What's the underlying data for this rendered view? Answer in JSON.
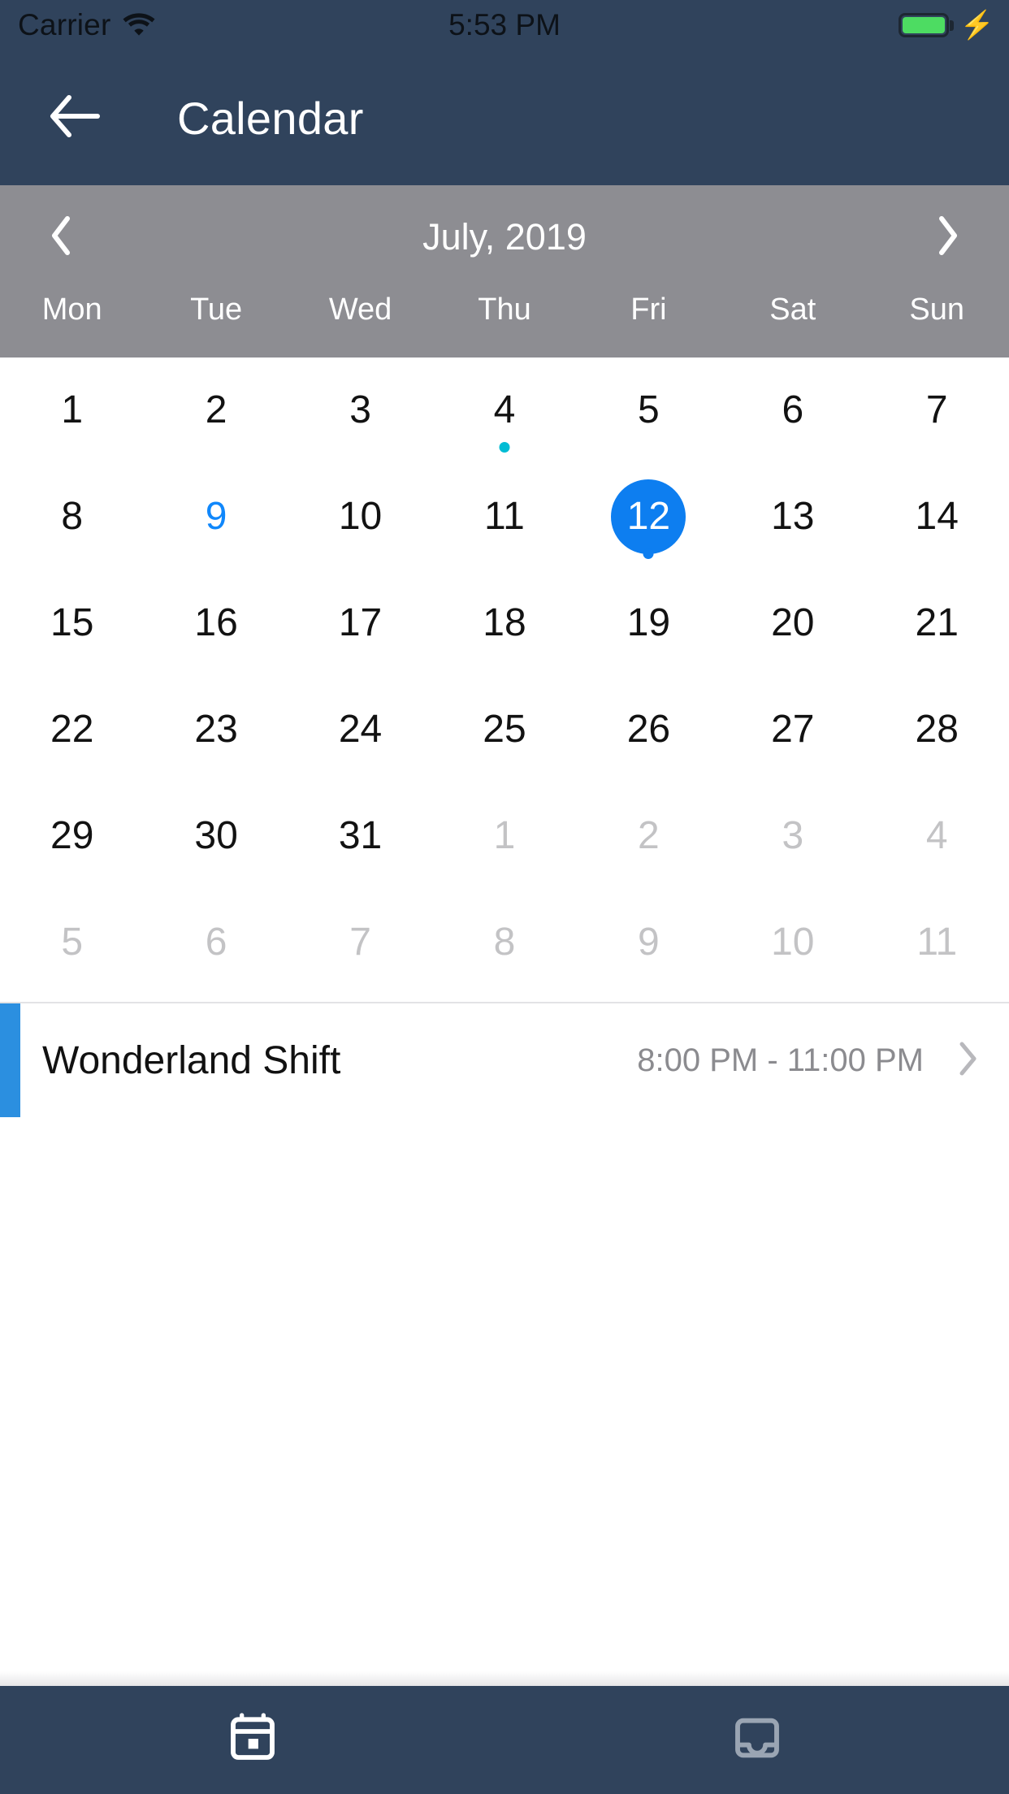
{
  "status_bar": {
    "carrier": "Carrier",
    "wifi_icon": "wifi-icon",
    "time": "5:53 PM",
    "battery_icon": "battery-full-icon",
    "charging_icon": "lightning-bolt-icon",
    "battery_color": "#4ddc62"
  },
  "nav_bar": {
    "back_icon": "arrow-left-icon",
    "title": "Calendar",
    "background": "#30435c"
  },
  "calendar": {
    "header_background": "#8d8d92",
    "month_label": "July, 2019",
    "prev_icon": "chevron-left-icon",
    "next_icon": "chevron-right-icon",
    "weekdays": [
      "Mon",
      "Tue",
      "Wed",
      "Thu",
      "Fri",
      "Sat",
      "Sun"
    ],
    "today": 9,
    "selected": 12,
    "selected_color": "#0d7ef0",
    "today_color": "#1087fb",
    "event_dot_colors": {
      "4": "#00bcd4",
      "12": "#0d7ef0"
    },
    "weeks": [
      [
        {
          "day": "1",
          "muted": false,
          "today": false,
          "selected": false,
          "dot": null
        },
        {
          "day": "2",
          "muted": false,
          "today": false,
          "selected": false,
          "dot": null
        },
        {
          "day": "3",
          "muted": false,
          "today": false,
          "selected": false,
          "dot": null
        },
        {
          "day": "4",
          "muted": false,
          "today": false,
          "selected": false,
          "dot": "#00bcd4"
        },
        {
          "day": "5",
          "muted": false,
          "today": false,
          "selected": false,
          "dot": null
        },
        {
          "day": "6",
          "muted": false,
          "today": false,
          "selected": false,
          "dot": null
        },
        {
          "day": "7",
          "muted": false,
          "today": false,
          "selected": false,
          "dot": null
        }
      ],
      [
        {
          "day": "8",
          "muted": false,
          "today": false,
          "selected": false,
          "dot": null
        },
        {
          "day": "9",
          "muted": false,
          "today": true,
          "selected": false,
          "dot": null
        },
        {
          "day": "10",
          "muted": false,
          "today": false,
          "selected": false,
          "dot": null
        },
        {
          "day": "11",
          "muted": false,
          "today": false,
          "selected": false,
          "dot": null
        },
        {
          "day": "12",
          "muted": false,
          "today": false,
          "selected": true,
          "dot": "#0d7ef0"
        },
        {
          "day": "13",
          "muted": false,
          "today": false,
          "selected": false,
          "dot": null
        },
        {
          "day": "14",
          "muted": false,
          "today": false,
          "selected": false,
          "dot": null
        }
      ],
      [
        {
          "day": "15",
          "muted": false,
          "today": false,
          "selected": false,
          "dot": null
        },
        {
          "day": "16",
          "muted": false,
          "today": false,
          "selected": false,
          "dot": null
        },
        {
          "day": "17",
          "muted": false,
          "today": false,
          "selected": false,
          "dot": null
        },
        {
          "day": "18",
          "muted": false,
          "today": false,
          "selected": false,
          "dot": null
        },
        {
          "day": "19",
          "muted": false,
          "today": false,
          "selected": false,
          "dot": null
        },
        {
          "day": "20",
          "muted": false,
          "today": false,
          "selected": false,
          "dot": null
        },
        {
          "day": "21",
          "muted": false,
          "today": false,
          "selected": false,
          "dot": null
        }
      ],
      [
        {
          "day": "22",
          "muted": false,
          "today": false,
          "selected": false,
          "dot": null
        },
        {
          "day": "23",
          "muted": false,
          "today": false,
          "selected": false,
          "dot": null
        },
        {
          "day": "24",
          "muted": false,
          "today": false,
          "selected": false,
          "dot": null
        },
        {
          "day": "25",
          "muted": false,
          "today": false,
          "selected": false,
          "dot": null
        },
        {
          "day": "26",
          "muted": false,
          "today": false,
          "selected": false,
          "dot": null
        },
        {
          "day": "27",
          "muted": false,
          "today": false,
          "selected": false,
          "dot": null
        },
        {
          "day": "28",
          "muted": false,
          "today": false,
          "selected": false,
          "dot": null
        }
      ],
      [
        {
          "day": "29",
          "muted": false,
          "today": false,
          "selected": false,
          "dot": null
        },
        {
          "day": "30",
          "muted": false,
          "today": false,
          "selected": false,
          "dot": null
        },
        {
          "day": "31",
          "muted": false,
          "today": false,
          "selected": false,
          "dot": null
        },
        {
          "day": "1",
          "muted": true,
          "today": false,
          "selected": false,
          "dot": null
        },
        {
          "day": "2",
          "muted": true,
          "today": false,
          "selected": false,
          "dot": null
        },
        {
          "day": "3",
          "muted": true,
          "today": false,
          "selected": false,
          "dot": null
        },
        {
          "day": "4",
          "muted": true,
          "today": false,
          "selected": false,
          "dot": null
        }
      ],
      [
        {
          "day": "5",
          "muted": true,
          "today": false,
          "selected": false,
          "dot": null
        },
        {
          "day": "6",
          "muted": true,
          "today": false,
          "selected": false,
          "dot": null
        },
        {
          "day": "7",
          "muted": true,
          "today": false,
          "selected": false,
          "dot": null
        },
        {
          "day": "8",
          "muted": true,
          "today": false,
          "selected": false,
          "dot": null
        },
        {
          "day": "9",
          "muted": true,
          "today": false,
          "selected": false,
          "dot": null
        },
        {
          "day": "10",
          "muted": true,
          "today": false,
          "selected": false,
          "dot": null
        },
        {
          "day": "11",
          "muted": true,
          "today": false,
          "selected": false,
          "dot": null
        }
      ]
    ]
  },
  "events": [
    {
      "title": "Wonderland Shift",
      "time": "8:00 PM - 11:00 PM",
      "accent_color": "#2b8fe0",
      "chevron_icon": "chevron-right-icon"
    }
  ],
  "tab_bar": {
    "background": "#30435c",
    "tabs": [
      {
        "icon": "calendar-icon",
        "active": true
      },
      {
        "icon": "inbox-icon",
        "active": false
      }
    ]
  }
}
